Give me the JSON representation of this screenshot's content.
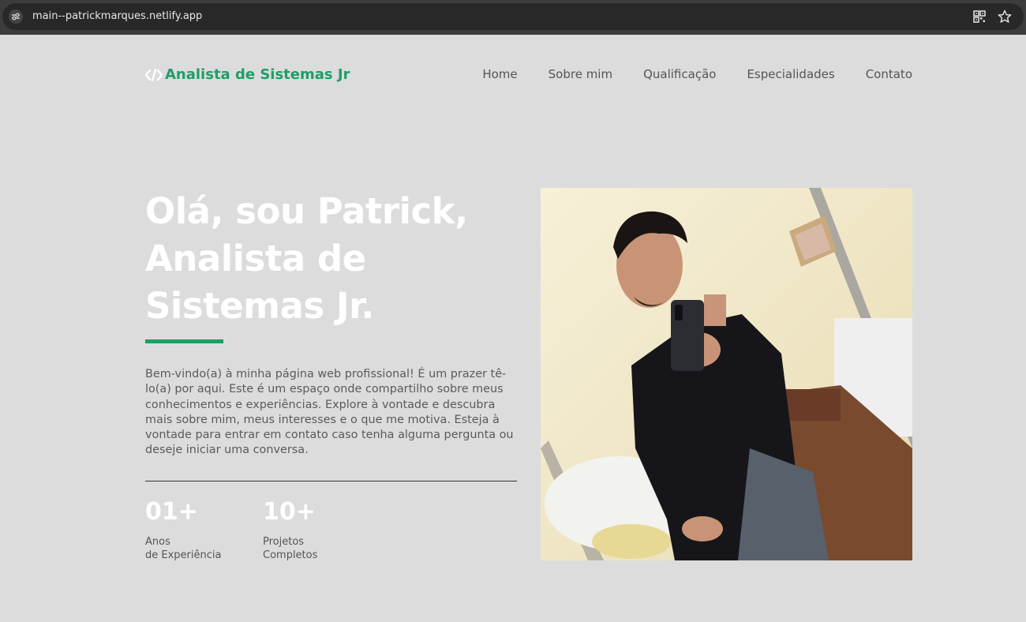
{
  "browser": {
    "url": "main--patrickmarques.netlify.app",
    "icons": [
      "site-settings-icon",
      "qr-code-icon",
      "star-icon"
    ]
  },
  "header": {
    "brand": "Analista de Sistemas Jr",
    "brand_icon": "code-icon",
    "nav": [
      "Home",
      "Sobre mim",
      "Qualificação",
      "Especialidades",
      "Contato"
    ]
  },
  "hero": {
    "title_lines": [
      "Olá, sou Patrick,",
      "Analista de",
      "Sistemas Jr."
    ],
    "intro": "Bem-vindo(a) à minha página web profissional! É um prazer tê-lo(a) por aqui. Este é um espaço onde compartilho sobre meus conhecimentos e experiências. Explore à vontade e descubra mais sobre mim, meus interesses e o que me motiva. Esteja à vontade para entrar em contato caso tenha alguma pergunta ou deseje iniciar uma conversa.",
    "stats": [
      {
        "value": "01+",
        "label": "Anos\nde Experiência"
      },
      {
        "value": "10+",
        "label": "Projetos\nCompletos"
      }
    ],
    "photo_subject": "profile-photo"
  },
  "colors": {
    "accent": "#1e9e68",
    "background": "#dcdcdc",
    "title": "#ffffff"
  }
}
